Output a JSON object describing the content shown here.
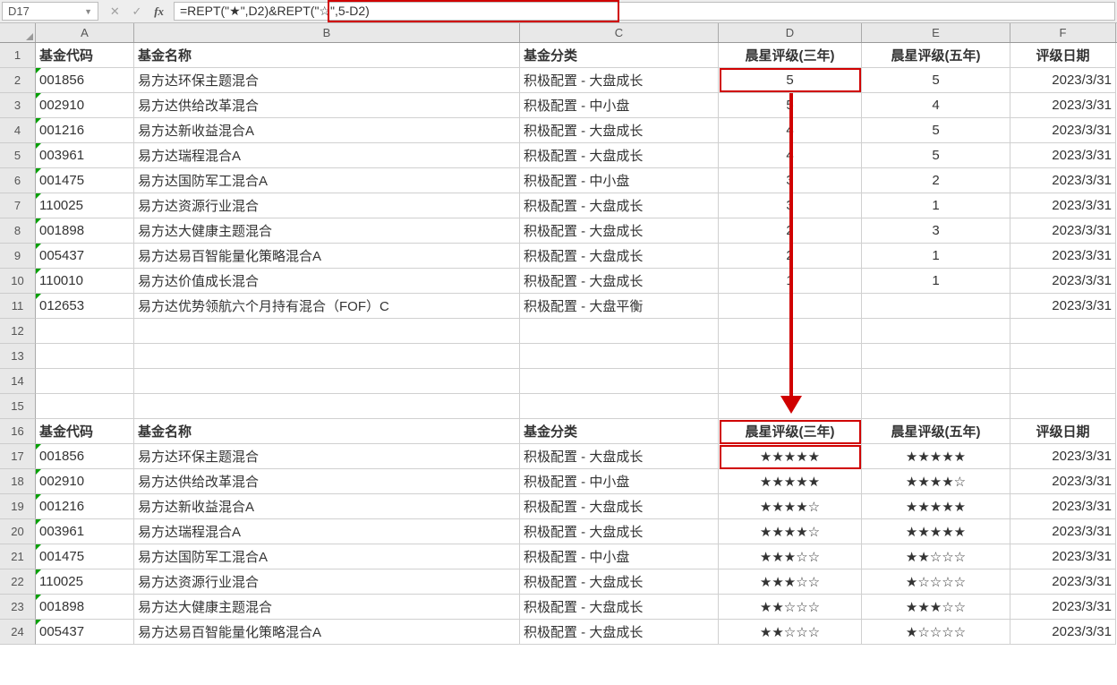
{
  "nameBox": "D17",
  "formula": "=REPT(\"★\",D2)&REPT(\"☆\",5-D2)",
  "columns": [
    "A",
    "B",
    "C",
    "D",
    "E",
    "F"
  ],
  "headers": {
    "code": "基金代码",
    "name": "基金名称",
    "category": "基金分类",
    "rating3": "晨星评级(三年)",
    "rating5": "晨星评级(五年)",
    "date": "评级日期"
  },
  "topRows": [
    {
      "code": "001856",
      "name": "易方达环保主题混合",
      "cat": "积极配置 - 大盘成长",
      "r3": "5",
      "r5": "5",
      "date": "2023/3/31"
    },
    {
      "code": "002910",
      "name": "易方达供给改革混合",
      "cat": "积极配置 - 中小盘",
      "r3": "5",
      "r5": "4",
      "date": "2023/3/31"
    },
    {
      "code": "001216",
      "name": "易方达新收益混合A",
      "cat": "积极配置 - 大盘成长",
      "r3": "4",
      "r5": "5",
      "date": "2023/3/31"
    },
    {
      "code": "003961",
      "name": "易方达瑞程混合A",
      "cat": "积极配置 - 大盘成长",
      "r3": "4",
      "r5": "5",
      "date": "2023/3/31"
    },
    {
      "code": "001475",
      "name": "易方达国防军工混合A",
      "cat": "积极配置 - 中小盘",
      "r3": "3",
      "r5": "2",
      "date": "2023/3/31"
    },
    {
      "code": "110025",
      "name": "易方达资源行业混合",
      "cat": "积极配置 - 大盘成长",
      "r3": "3",
      "r5": "1",
      "date": "2023/3/31"
    },
    {
      "code": "001898",
      "name": "易方达大健康主题混合",
      "cat": "积极配置 - 大盘成长",
      "r3": "2",
      "r5": "3",
      "date": "2023/3/31"
    },
    {
      "code": "005437",
      "name": "易方达易百智能量化策略混合A",
      "cat": "积极配置 - 大盘成长",
      "r3": "2",
      "r5": "1",
      "date": "2023/3/31"
    },
    {
      "code": "110010",
      "name": "易方达价值成长混合",
      "cat": "积极配置 - 大盘成长",
      "r3": "1",
      "r5": "1",
      "date": "2023/3/31"
    },
    {
      "code": "012653",
      "name": "易方达优势领航六个月持有混合（FOF）C",
      "cat": "积极配置 - 大盘平衡",
      "r3": "",
      "r5": "",
      "date": "2023/3/31"
    }
  ],
  "bottomRows": [
    {
      "code": "001856",
      "name": "易方达环保主题混合",
      "cat": "积极配置 - 大盘成长",
      "r3": "★★★★★",
      "r5": "★★★★★",
      "date": "2023/3/31"
    },
    {
      "code": "002910",
      "name": "易方达供给改革混合",
      "cat": "积极配置 - 中小盘",
      "r3": "★★★★★",
      "r5": "★★★★☆",
      "date": "2023/3/31"
    },
    {
      "code": "001216",
      "name": "易方达新收益混合A",
      "cat": "积极配置 - 大盘成长",
      "r3": "★★★★☆",
      "r5": "★★★★★",
      "date": "2023/3/31"
    },
    {
      "code": "003961",
      "name": "易方达瑞程混合A",
      "cat": "积极配置 - 大盘成长",
      "r3": "★★★★☆",
      "r5": "★★★★★",
      "date": "2023/3/31"
    },
    {
      "code": "001475",
      "name": "易方达国防军工混合A",
      "cat": "积极配置 - 中小盘",
      "r3": "★★★☆☆",
      "r5": "★★☆☆☆",
      "date": "2023/3/31"
    },
    {
      "code": "110025",
      "name": "易方达资源行业混合",
      "cat": "积极配置 - 大盘成长",
      "r3": "★★★☆☆",
      "r5": "★☆☆☆☆",
      "date": "2023/3/31"
    },
    {
      "code": "001898",
      "name": "易方达大健康主题混合",
      "cat": "积极配置 - 大盘成长",
      "r3": "★★☆☆☆",
      "r5": "★★★☆☆",
      "date": "2023/3/31"
    },
    {
      "code": "005437",
      "name": "易方达易百智能量化策略混合A",
      "cat": "积极配置 - 大盘成长",
      "r3": "★★☆☆☆",
      "r5": "★☆☆☆☆",
      "date": "2023/3/31"
    }
  ],
  "rowNumbers": [
    "1",
    "2",
    "3",
    "4",
    "5",
    "6",
    "7",
    "8",
    "9",
    "10",
    "11",
    "12",
    "13",
    "14",
    "15",
    "16",
    "17",
    "18",
    "19",
    "20",
    "21",
    "22",
    "23",
    "24"
  ]
}
